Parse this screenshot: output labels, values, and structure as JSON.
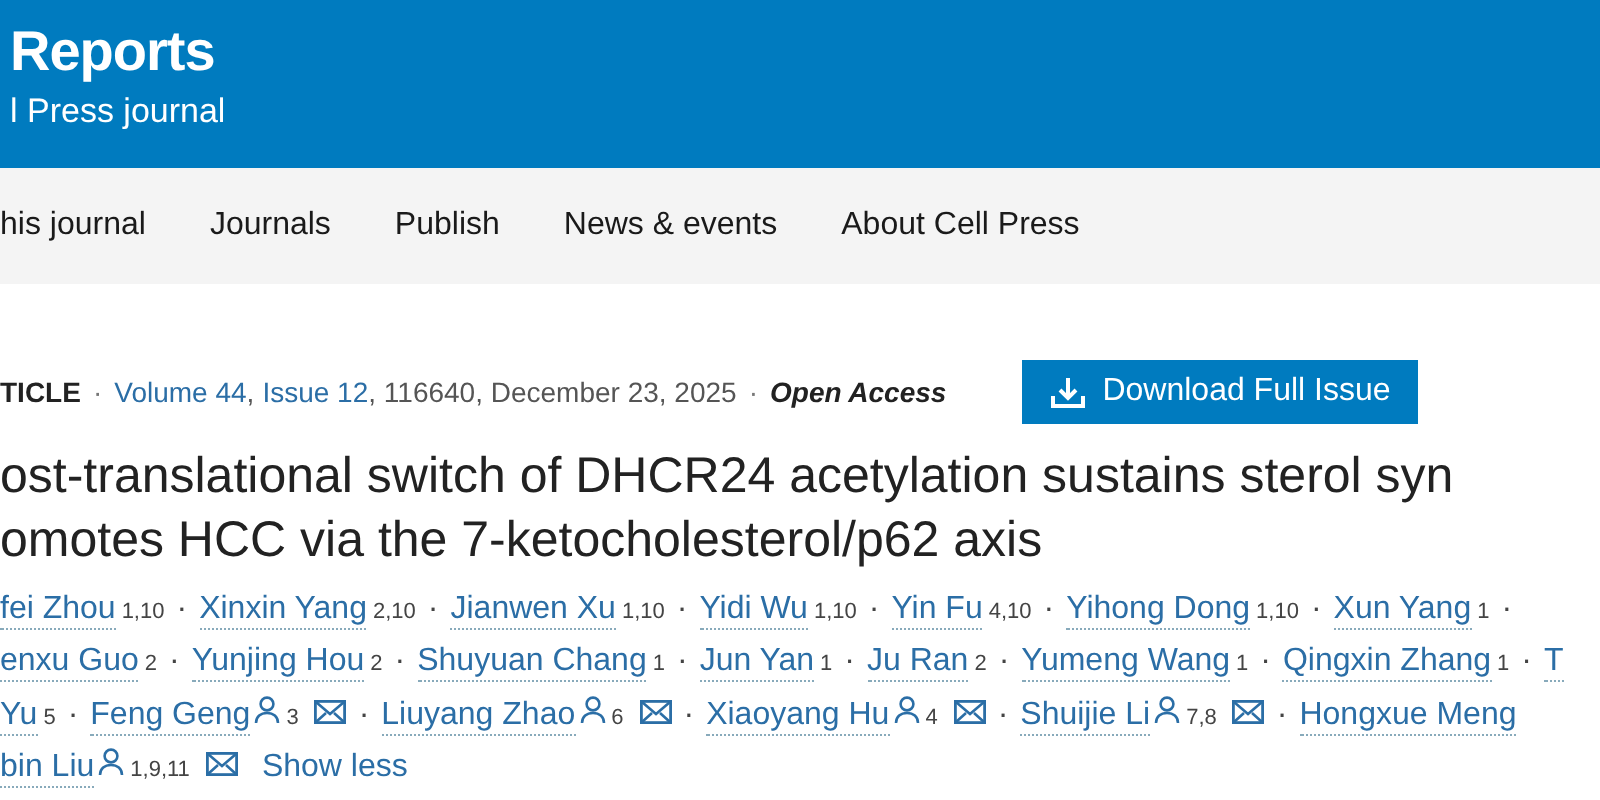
{
  "header": {
    "title": "Reports",
    "subtitle": "l Press journal"
  },
  "nav": [
    "his journal",
    "Journals",
    "Publish",
    "News & events",
    "About Cell Press"
  ],
  "meta": {
    "type": "TICLE",
    "volume": "Volume 44",
    "issue": "Issue 12",
    "comma": ",",
    "sep": "·",
    "details": ", 116640, December 23, 2025",
    "access": "Open Access"
  },
  "download_button": "Download Full Issue",
  "title": [
    "ost-translational switch of DHCR24 acetylation sustains sterol syn",
    "omotes HCC via the 7-ketocholesterol/p62 axis"
  ],
  "authors": [
    [
      {
        "name": "fei Zhou",
        "sup": "1,10",
        "after": "·"
      },
      {
        "name": "Xinxin Yang",
        "sup": "2,10",
        "after": "·"
      },
      {
        "name": "Jianwen Xu",
        "sup": "1,10",
        "after": "·"
      },
      {
        "name": "Yidi Wu",
        "sup": "1,10",
        "after": "·"
      },
      {
        "name": "Yin Fu",
        "sup": "4,10",
        "after": "·"
      },
      {
        "name": "Yihong Dong",
        "sup": "1,10",
        "after": "·"
      },
      {
        "name": "Xun Yang",
        "sup": "1",
        "after": "·"
      }
    ],
    [
      {
        "name": "enxu Guo",
        "sup": "2",
        "after": "·"
      },
      {
        "name": "Yunjing Hou",
        "sup": "2",
        "after": "·"
      },
      {
        "name": "Shuyuan Chang",
        "sup": "1",
        "after": "·"
      },
      {
        "name": "Jun Yan",
        "sup": "1",
        "after": "·"
      },
      {
        "name": "Ju Ran",
        "sup": "2",
        "after": "·"
      },
      {
        "name": "Yumeng Wang",
        "sup": "1",
        "after": "·"
      },
      {
        "name": "Qingxin Zhang",
        "sup": "1",
        "after": "·"
      },
      {
        "name": "T"
      }
    ],
    [
      {
        "name": "Yu",
        "sup": "5",
        "after": "·"
      },
      {
        "name": "Feng Geng",
        "corresponding": true,
        "sup": "3",
        "email": true,
        "after": "·"
      },
      {
        "name": "Liuyang Zhao",
        "corresponding": true,
        "sup": "6",
        "email": true,
        "after": "·"
      },
      {
        "name": "Xiaoyang Hu",
        "corresponding": true,
        "sup": "4",
        "email": true,
        "after": "·"
      },
      {
        "name": "Shuijie Li",
        "corresponding": true,
        "sup": "7,8",
        "email": true,
        "after": "·"
      },
      {
        "name": "Hongxue Meng"
      }
    ],
    [
      {
        "name": "bin Liu",
        "corresponding": true,
        "sup": "1,9,11",
        "email": true
      }
    ]
  ],
  "show_less": "Show less"
}
